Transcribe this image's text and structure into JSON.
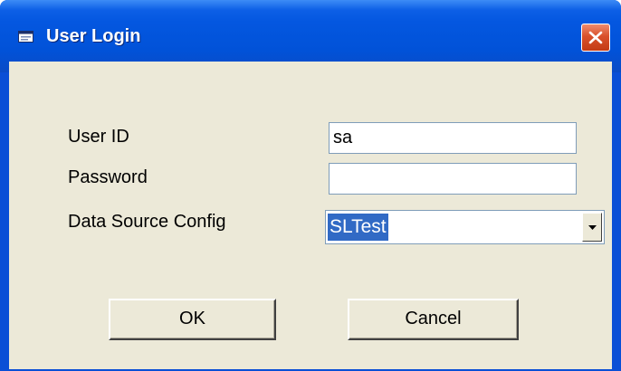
{
  "window": {
    "title": "User Login",
    "icon": "window-app-icon",
    "close_icon": "close-icon"
  },
  "form": {
    "user_id_label": "User ID",
    "user_id_value": "sa",
    "password_label": "Password",
    "password_value": "",
    "data_source_label": "Data Source Config",
    "data_source_value": "SLTest",
    "dropdown_icon": "chevron-down-icon"
  },
  "buttons": {
    "ok_label": "OK",
    "cancel_label": "Cancel"
  },
  "colors": {
    "titlebar": "#0152d8",
    "close_button": "#d9512b",
    "client_background": "#ece9d8",
    "selection": "#316ac5"
  }
}
